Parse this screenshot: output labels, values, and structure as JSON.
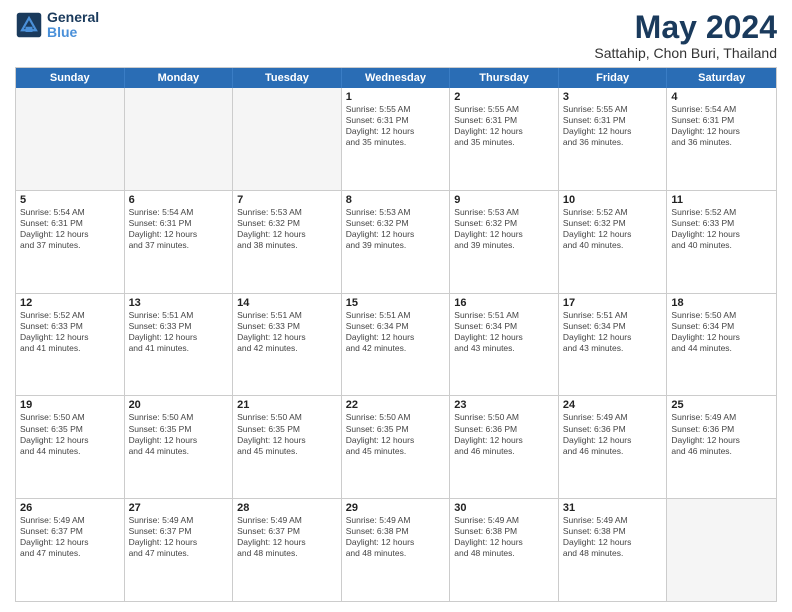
{
  "logo": {
    "line1": "General",
    "line2": "Blue"
  },
  "title": "May 2024",
  "subtitle": "Sattahip, Chon Buri, Thailand",
  "days": [
    "Sunday",
    "Monday",
    "Tuesday",
    "Wednesday",
    "Thursday",
    "Friday",
    "Saturday"
  ],
  "weeks": [
    [
      {
        "num": "",
        "info": "",
        "empty": true
      },
      {
        "num": "",
        "info": "",
        "empty": true
      },
      {
        "num": "",
        "info": "",
        "empty": true
      },
      {
        "num": "1",
        "info": "Sunrise: 5:55 AM\nSunset: 6:31 PM\nDaylight: 12 hours\nand 35 minutes."
      },
      {
        "num": "2",
        "info": "Sunrise: 5:55 AM\nSunset: 6:31 PM\nDaylight: 12 hours\nand 35 minutes."
      },
      {
        "num": "3",
        "info": "Sunrise: 5:55 AM\nSunset: 6:31 PM\nDaylight: 12 hours\nand 36 minutes."
      },
      {
        "num": "4",
        "info": "Sunrise: 5:54 AM\nSunset: 6:31 PM\nDaylight: 12 hours\nand 36 minutes."
      }
    ],
    [
      {
        "num": "5",
        "info": "Sunrise: 5:54 AM\nSunset: 6:31 PM\nDaylight: 12 hours\nand 37 minutes."
      },
      {
        "num": "6",
        "info": "Sunrise: 5:54 AM\nSunset: 6:31 PM\nDaylight: 12 hours\nand 37 minutes."
      },
      {
        "num": "7",
        "info": "Sunrise: 5:53 AM\nSunset: 6:32 PM\nDaylight: 12 hours\nand 38 minutes."
      },
      {
        "num": "8",
        "info": "Sunrise: 5:53 AM\nSunset: 6:32 PM\nDaylight: 12 hours\nand 39 minutes."
      },
      {
        "num": "9",
        "info": "Sunrise: 5:53 AM\nSunset: 6:32 PM\nDaylight: 12 hours\nand 39 minutes."
      },
      {
        "num": "10",
        "info": "Sunrise: 5:52 AM\nSunset: 6:32 PM\nDaylight: 12 hours\nand 40 minutes."
      },
      {
        "num": "11",
        "info": "Sunrise: 5:52 AM\nSunset: 6:33 PM\nDaylight: 12 hours\nand 40 minutes."
      }
    ],
    [
      {
        "num": "12",
        "info": "Sunrise: 5:52 AM\nSunset: 6:33 PM\nDaylight: 12 hours\nand 41 minutes."
      },
      {
        "num": "13",
        "info": "Sunrise: 5:51 AM\nSunset: 6:33 PM\nDaylight: 12 hours\nand 41 minutes."
      },
      {
        "num": "14",
        "info": "Sunrise: 5:51 AM\nSunset: 6:33 PM\nDaylight: 12 hours\nand 42 minutes."
      },
      {
        "num": "15",
        "info": "Sunrise: 5:51 AM\nSunset: 6:34 PM\nDaylight: 12 hours\nand 42 minutes."
      },
      {
        "num": "16",
        "info": "Sunrise: 5:51 AM\nSunset: 6:34 PM\nDaylight: 12 hours\nand 43 minutes."
      },
      {
        "num": "17",
        "info": "Sunrise: 5:51 AM\nSunset: 6:34 PM\nDaylight: 12 hours\nand 43 minutes."
      },
      {
        "num": "18",
        "info": "Sunrise: 5:50 AM\nSunset: 6:34 PM\nDaylight: 12 hours\nand 44 minutes."
      }
    ],
    [
      {
        "num": "19",
        "info": "Sunrise: 5:50 AM\nSunset: 6:35 PM\nDaylight: 12 hours\nand 44 minutes."
      },
      {
        "num": "20",
        "info": "Sunrise: 5:50 AM\nSunset: 6:35 PM\nDaylight: 12 hours\nand 44 minutes."
      },
      {
        "num": "21",
        "info": "Sunrise: 5:50 AM\nSunset: 6:35 PM\nDaylight: 12 hours\nand 45 minutes."
      },
      {
        "num": "22",
        "info": "Sunrise: 5:50 AM\nSunset: 6:35 PM\nDaylight: 12 hours\nand 45 minutes."
      },
      {
        "num": "23",
        "info": "Sunrise: 5:50 AM\nSunset: 6:36 PM\nDaylight: 12 hours\nand 46 minutes."
      },
      {
        "num": "24",
        "info": "Sunrise: 5:49 AM\nSunset: 6:36 PM\nDaylight: 12 hours\nand 46 minutes."
      },
      {
        "num": "25",
        "info": "Sunrise: 5:49 AM\nSunset: 6:36 PM\nDaylight: 12 hours\nand 46 minutes."
      }
    ],
    [
      {
        "num": "26",
        "info": "Sunrise: 5:49 AM\nSunset: 6:37 PM\nDaylight: 12 hours\nand 47 minutes."
      },
      {
        "num": "27",
        "info": "Sunrise: 5:49 AM\nSunset: 6:37 PM\nDaylight: 12 hours\nand 47 minutes."
      },
      {
        "num": "28",
        "info": "Sunrise: 5:49 AM\nSunset: 6:37 PM\nDaylight: 12 hours\nand 48 minutes."
      },
      {
        "num": "29",
        "info": "Sunrise: 5:49 AM\nSunset: 6:38 PM\nDaylight: 12 hours\nand 48 minutes."
      },
      {
        "num": "30",
        "info": "Sunrise: 5:49 AM\nSunset: 6:38 PM\nDaylight: 12 hours\nand 48 minutes."
      },
      {
        "num": "31",
        "info": "Sunrise: 5:49 AM\nSunset: 6:38 PM\nDaylight: 12 hours\nand 48 minutes."
      },
      {
        "num": "",
        "info": "",
        "empty": true
      }
    ]
  ]
}
